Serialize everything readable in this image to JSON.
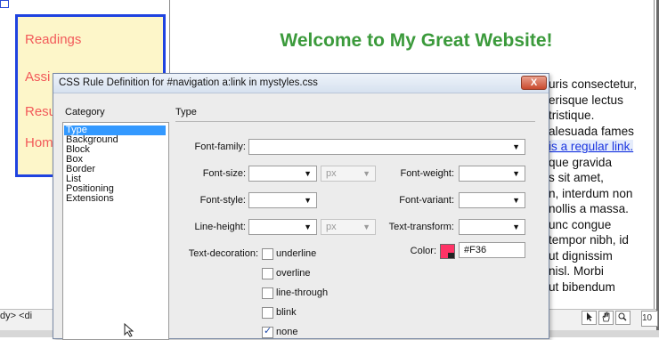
{
  "page": {
    "nav_links": [
      "Readings",
      "Assi",
      "Resu",
      "Hom"
    ],
    "heading": "Welcome to My Great Website!",
    "lorem_lines": [
      "uris consectetur,",
      "erisque lectus",
      " tristique.",
      "alesuada fames",
      " is a regular link.",
      "que gravida",
      "s sit amet,",
      "n, interdum non",
      "nollis a massa.",
      "unc congue",
      " tempor nibh, id",
      "ut dignissim",
      "nisl. Morbi",
      "ut bibendum"
    ]
  },
  "statusbar": {
    "tag_path": "dy> <di",
    "zoom": "10",
    "tools": [
      "arrow-icon",
      "hand-icon",
      "zoom-icon"
    ]
  },
  "dialog": {
    "title": "CSS Rule Definition for #navigation a:link in mystyles.css",
    "close_label": "X",
    "category_header": "Category",
    "categories": [
      "Type",
      "Background",
      "Block",
      "Box",
      "Border",
      "List",
      "Positioning",
      "Extensions"
    ],
    "selected_category": "Type",
    "panel_header": "Type",
    "labels": {
      "font_family": "Font-family:",
      "font_size": "Font-size:",
      "font_weight": "Font-weight:",
      "font_style": "Font-style:",
      "font_variant": "Font-variant:",
      "line_height": "Line-height:",
      "text_transform": "Text-transform:",
      "text_decoration": "Text-decoration:",
      "color": "Color:"
    },
    "units": {
      "font_size": "px",
      "line_height": "px"
    },
    "color_value": "#F36",
    "color_swatch": "#ff3366",
    "decorations": [
      {
        "label": "underline",
        "checked": false
      },
      {
        "label": "overline",
        "checked": false
      },
      {
        "label": "line-through",
        "checked": false
      },
      {
        "label": "blink",
        "checked": false
      },
      {
        "label": "none",
        "checked": true
      }
    ]
  },
  "colors": {
    "nav_border": "#1f43e0",
    "nav_bg": "#fdf6c9",
    "nav_link": "#f25a5a",
    "heading": "#3b9a3b",
    "link": "#1a35e0",
    "selection": "#3399ff"
  }
}
